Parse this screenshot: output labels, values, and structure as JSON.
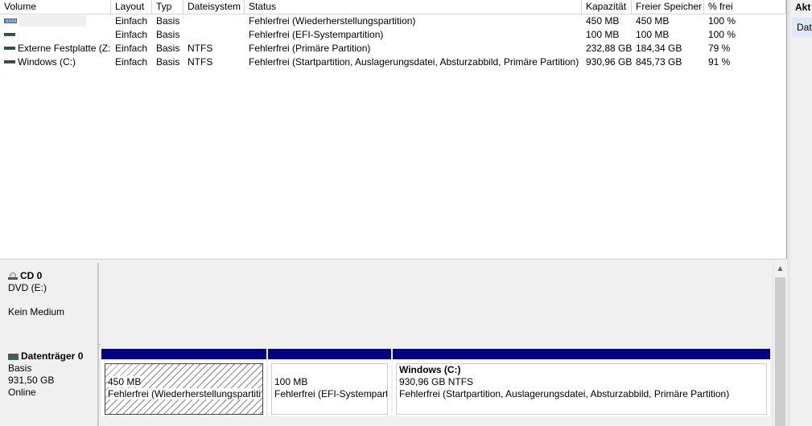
{
  "columns": {
    "volume": "Volume",
    "layout": "Layout",
    "typ": "Typ",
    "dateisystem": "Dateisystem",
    "status": "Status",
    "kapazitaet": "Kapazität",
    "freier_speicher": "Freier Speicher",
    "prozent_frei": "% frei"
  },
  "volumes": [
    {
      "name": "",
      "icon": "striped-volume-icon",
      "layout": "Einfach",
      "typ": "Basis",
      "dateisystem": "",
      "status": "Fehlerfrei (Wiederherstellungspartition)",
      "kapazitaet": "450 MB",
      "frei": "450 MB",
      "prozent": "100 %"
    },
    {
      "name": "",
      "icon": "volume-icon",
      "layout": "Einfach",
      "typ": "Basis",
      "dateisystem": "",
      "status": "Fehlerfrei (EFI-Systempartition)",
      "kapazitaet": "100 MB",
      "frei": "100 MB",
      "prozent": "100 %"
    },
    {
      "name": "Externe Festplatte (Z:)",
      "icon": "volume-icon",
      "layout": "Einfach",
      "typ": "Basis",
      "dateisystem": "NTFS",
      "status": "Fehlerfrei (Primäre Partition)",
      "kapazitaet": "232,88 GB",
      "frei": "184,34 GB",
      "prozent": "79 %"
    },
    {
      "name": "Windows (C:)",
      "icon": "volume-icon",
      "layout": "Einfach",
      "typ": "Basis",
      "dateisystem": "NTFS",
      "status": "Fehlerfrei (Startpartition, Auslagerungsdatei, Absturzabbild, Primäre Partition)",
      "kapazitaet": "930,96 GB",
      "frei": "845,73 GB",
      "prozent": "91 %"
    }
  ],
  "cd": {
    "title": "CD 0",
    "drive": "DVD (E:)",
    "medium": "Kein Medium"
  },
  "disk0": {
    "title": "Datenträger 0",
    "type": "Basis",
    "size": "931,50 GB",
    "state": "Online",
    "partitions": [
      {
        "name": "",
        "size": "450 MB",
        "status": "Fehlerfrei (Wiederherstellungspartiti"
      },
      {
        "name": "",
        "size": "100 MB",
        "status": "Fehlerfrei (EFI-Systempartit"
      },
      {
        "name": "Windows  (C:)",
        "size": "930,96 GB NTFS",
        "status": "Fehlerfrei (Startpartition, Auslagerungsdatei, Absturzabbild, Primäre Partition)"
      }
    ]
  },
  "actions": {
    "title": "Akt",
    "item": "Dat"
  },
  "colors": {
    "partition_header": "#000080",
    "pane_background": "#f0f0f0",
    "selection": "#dfe9f5"
  }
}
